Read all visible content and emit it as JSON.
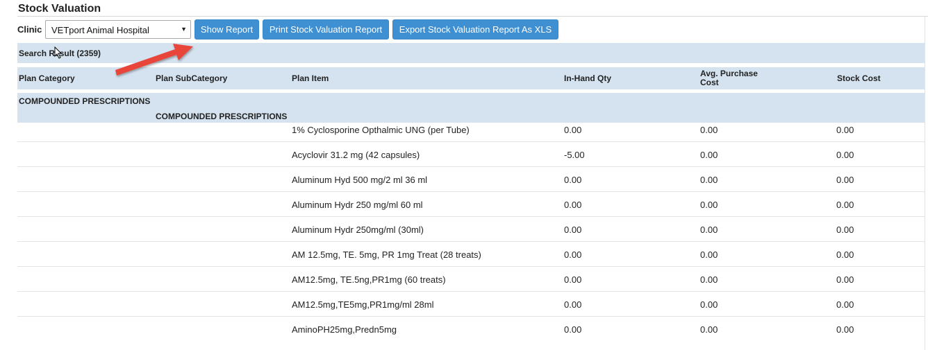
{
  "page": {
    "title": "Stock Valuation"
  },
  "toolbar": {
    "clinic_label": "Clinic",
    "clinic_selected": "VETport Animal Hospital",
    "show_report_label": "Show Report",
    "print_label": "Print Stock Valuation Report",
    "export_label": "Export Stock Valuation Report As XLS"
  },
  "search": {
    "result_text": "Search Result (2359)"
  },
  "table": {
    "headers": {
      "plan_category": "Plan Category",
      "plan_subcategory": "Plan SubCategory",
      "plan_item": "Plan Item",
      "in_hand_qty": "In-Hand Qty",
      "avg_purchase_cost_1": "Avg. Purchase",
      "avg_purchase_cost_2": "Cost",
      "stock_cost": "Stock Cost"
    },
    "category": "COMPOUNDED PRESCRIPTIONS",
    "subcategory": "COMPOUNDED PRESCRIPTIONS",
    "rows": [
      {
        "item": "1% Cyclosporine Opthalmic UNG (per Tube)",
        "qty": "0.00",
        "avg": "0.00",
        "cost": "0.00"
      },
      {
        "item": "Acyclovir 31.2 mg (42 capsules)",
        "qty": "-5.00",
        "avg": "0.00",
        "cost": "0.00"
      },
      {
        "item": "Aluminum Hyd 500 mg/2 ml 36 ml",
        "qty": "0.00",
        "avg": "0.00",
        "cost": "0.00"
      },
      {
        "item": "Aluminum Hydr 250 mg/ml 60 ml",
        "qty": "0.00",
        "avg": "0.00",
        "cost": "0.00"
      },
      {
        "item": "Aluminum Hydr 250mg/ml (30ml)",
        "qty": "0.00",
        "avg": "0.00",
        "cost": "0.00"
      },
      {
        "item": "AM 12.5mg, TE. 5mg, PR 1mg Treat (28 treats)",
        "qty": "0.00",
        "avg": "0.00",
        "cost": "0.00"
      },
      {
        "item": "AM12.5mg, TE.5ng,PR1mg (60 treats)",
        "qty": "0.00",
        "avg": "0.00",
        "cost": "0.00"
      },
      {
        "item": "AM12.5mg,TE5mg,PR1mg/ml 28ml",
        "qty": "0.00",
        "avg": "0.00",
        "cost": "0.00"
      },
      {
        "item": "AminoPH25mg,Predn5mg",
        "qty": "0.00",
        "avg": "0.00",
        "cost": "0.00"
      }
    ]
  },
  "colors": {
    "button": "#3f8fd3",
    "band": "#d5e3f0",
    "annotation_arrow": "#e8443a"
  }
}
